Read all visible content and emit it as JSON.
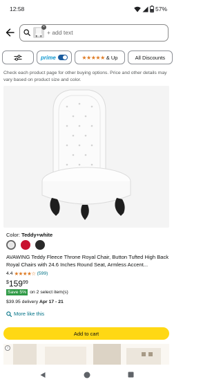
{
  "status_bar": {
    "time": "12:58",
    "battery": "57%",
    "icons": [
      "wifi-icon",
      "signal-icon",
      "battery-icon"
    ]
  },
  "search": {
    "placeholder": "+ add text",
    "icons": [
      "back-arrow-icon",
      "search-icon",
      "image-thumbnail"
    ]
  },
  "filters": {
    "sort_icon": "sliders-icon",
    "prime_label": "prime",
    "prime_toggle_on": true,
    "stars_label": "★★★★★",
    "stars_suffix": "& Up",
    "discounts_label": "All Discounts"
  },
  "notice": "Check each product page for other buying options. Price and other details may vary based on product size and color.",
  "product": {
    "color_label": "Color:",
    "color_value": "Teddy+white",
    "swatches": [
      {
        "name": "white",
        "color": "#ffffff",
        "selected": true
      },
      {
        "name": "red",
        "color": "#c8102e",
        "selected": false
      },
      {
        "name": "black",
        "color": "#2a2a2a",
        "selected": false
      }
    ],
    "title": "AVAWING Teddy Fleece Throne Royal Chair, Button Tufted High Back Royal Chairs with 24.6 Inches Round Seat, Armless Accent...",
    "rating_value": "4.4",
    "rating_stars": "★★★★☆",
    "rating_count": "(599)",
    "rating": 4.4,
    "price_symbol": "$",
    "price_whole": "159",
    "price_fraction": "99",
    "save_badge": "Save 5%",
    "save_text": "on 2 select item(s)",
    "delivery_price": "$39.95 delivery",
    "delivery_dates": "Apr 17 - 21",
    "more_like_this": "More like this",
    "add_to_cart": "Add to cart"
  },
  "colors": {
    "accent_yellow": "#ffd814",
    "link_teal": "#007185",
    "star_orange": "#de7921",
    "save_green": "#2f9a46",
    "prime_blue": "#1399d1"
  },
  "nav_bar": {
    "icons": [
      "back-triangle-icon",
      "home-circle-icon",
      "recents-square-icon"
    ]
  }
}
